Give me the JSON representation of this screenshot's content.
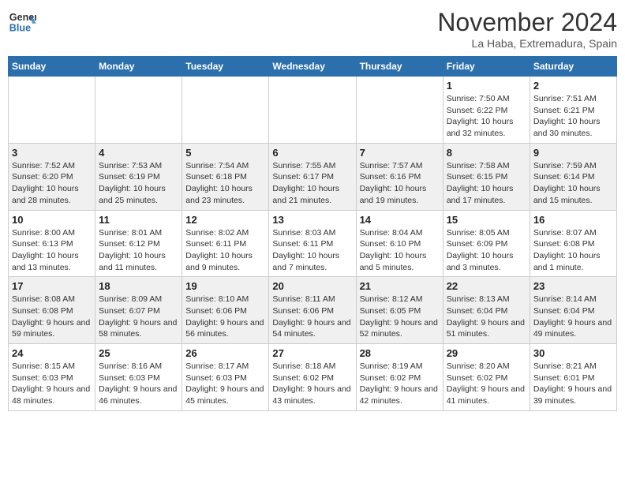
{
  "header": {
    "logo_line1": "General",
    "logo_line2": "Blue",
    "month_title": "November 2024",
    "location": "La Haba, Extremadura, Spain"
  },
  "days_of_week": [
    "Sunday",
    "Monday",
    "Tuesday",
    "Wednesday",
    "Thursday",
    "Friday",
    "Saturday"
  ],
  "weeks": [
    [
      {
        "day": "",
        "info": ""
      },
      {
        "day": "",
        "info": ""
      },
      {
        "day": "",
        "info": ""
      },
      {
        "day": "",
        "info": ""
      },
      {
        "day": "",
        "info": ""
      },
      {
        "day": "1",
        "info": "Sunrise: 7:50 AM\nSunset: 6:22 PM\nDaylight: 10 hours and 32 minutes."
      },
      {
        "day": "2",
        "info": "Sunrise: 7:51 AM\nSunset: 6:21 PM\nDaylight: 10 hours and 30 minutes."
      }
    ],
    [
      {
        "day": "3",
        "info": "Sunrise: 7:52 AM\nSunset: 6:20 PM\nDaylight: 10 hours and 28 minutes."
      },
      {
        "day": "4",
        "info": "Sunrise: 7:53 AM\nSunset: 6:19 PM\nDaylight: 10 hours and 25 minutes."
      },
      {
        "day": "5",
        "info": "Sunrise: 7:54 AM\nSunset: 6:18 PM\nDaylight: 10 hours and 23 minutes."
      },
      {
        "day": "6",
        "info": "Sunrise: 7:55 AM\nSunset: 6:17 PM\nDaylight: 10 hours and 21 minutes."
      },
      {
        "day": "7",
        "info": "Sunrise: 7:57 AM\nSunset: 6:16 PM\nDaylight: 10 hours and 19 minutes."
      },
      {
        "day": "8",
        "info": "Sunrise: 7:58 AM\nSunset: 6:15 PM\nDaylight: 10 hours and 17 minutes."
      },
      {
        "day": "9",
        "info": "Sunrise: 7:59 AM\nSunset: 6:14 PM\nDaylight: 10 hours and 15 minutes."
      }
    ],
    [
      {
        "day": "10",
        "info": "Sunrise: 8:00 AM\nSunset: 6:13 PM\nDaylight: 10 hours and 13 minutes."
      },
      {
        "day": "11",
        "info": "Sunrise: 8:01 AM\nSunset: 6:12 PM\nDaylight: 10 hours and 11 minutes."
      },
      {
        "day": "12",
        "info": "Sunrise: 8:02 AM\nSunset: 6:11 PM\nDaylight: 10 hours and 9 minutes."
      },
      {
        "day": "13",
        "info": "Sunrise: 8:03 AM\nSunset: 6:11 PM\nDaylight: 10 hours and 7 minutes."
      },
      {
        "day": "14",
        "info": "Sunrise: 8:04 AM\nSunset: 6:10 PM\nDaylight: 10 hours and 5 minutes."
      },
      {
        "day": "15",
        "info": "Sunrise: 8:05 AM\nSunset: 6:09 PM\nDaylight: 10 hours and 3 minutes."
      },
      {
        "day": "16",
        "info": "Sunrise: 8:07 AM\nSunset: 6:08 PM\nDaylight: 10 hours and 1 minute."
      }
    ],
    [
      {
        "day": "17",
        "info": "Sunrise: 8:08 AM\nSunset: 6:08 PM\nDaylight: 9 hours and 59 minutes."
      },
      {
        "day": "18",
        "info": "Sunrise: 8:09 AM\nSunset: 6:07 PM\nDaylight: 9 hours and 58 minutes."
      },
      {
        "day": "19",
        "info": "Sunrise: 8:10 AM\nSunset: 6:06 PM\nDaylight: 9 hours and 56 minutes."
      },
      {
        "day": "20",
        "info": "Sunrise: 8:11 AM\nSunset: 6:06 PM\nDaylight: 9 hours and 54 minutes."
      },
      {
        "day": "21",
        "info": "Sunrise: 8:12 AM\nSunset: 6:05 PM\nDaylight: 9 hours and 52 minutes."
      },
      {
        "day": "22",
        "info": "Sunrise: 8:13 AM\nSunset: 6:04 PM\nDaylight: 9 hours and 51 minutes."
      },
      {
        "day": "23",
        "info": "Sunrise: 8:14 AM\nSunset: 6:04 PM\nDaylight: 9 hours and 49 minutes."
      }
    ],
    [
      {
        "day": "24",
        "info": "Sunrise: 8:15 AM\nSunset: 6:03 PM\nDaylight: 9 hours and 48 minutes."
      },
      {
        "day": "25",
        "info": "Sunrise: 8:16 AM\nSunset: 6:03 PM\nDaylight: 9 hours and 46 minutes."
      },
      {
        "day": "26",
        "info": "Sunrise: 8:17 AM\nSunset: 6:03 PM\nDaylight: 9 hours and 45 minutes."
      },
      {
        "day": "27",
        "info": "Sunrise: 8:18 AM\nSunset: 6:02 PM\nDaylight: 9 hours and 43 minutes."
      },
      {
        "day": "28",
        "info": "Sunrise: 8:19 AM\nSunset: 6:02 PM\nDaylight: 9 hours and 42 minutes."
      },
      {
        "day": "29",
        "info": "Sunrise: 8:20 AM\nSunset: 6:02 PM\nDaylight: 9 hours and 41 minutes."
      },
      {
        "day": "30",
        "info": "Sunrise: 8:21 AM\nSunset: 6:01 PM\nDaylight: 9 hours and 39 minutes."
      }
    ]
  ]
}
